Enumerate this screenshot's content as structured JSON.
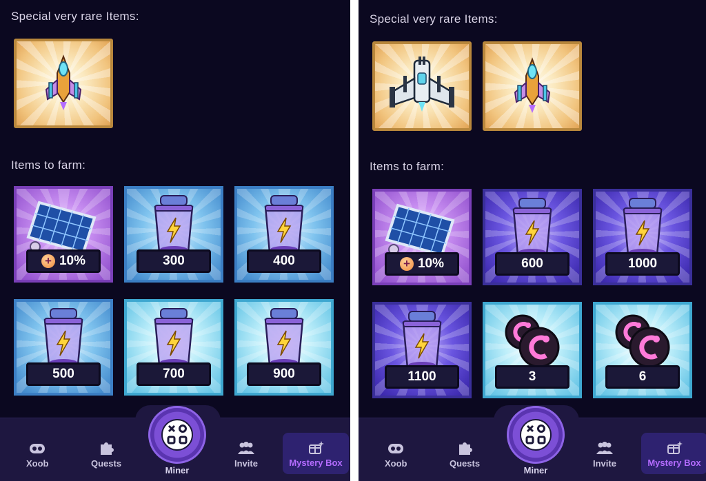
{
  "screens": [
    {
      "rare_heading": "Special very rare Items:",
      "rare_items": [
        {
          "icon": "golden-spaceship-icon"
        }
      ],
      "farm_heading": "Items to farm:",
      "farm_items": [
        {
          "icon": "solar-panel-icon",
          "value": "10%",
          "tone": "purple",
          "badge": "+"
        },
        {
          "icon": "energy-battery-icon",
          "value": "300",
          "tone": "blue"
        },
        {
          "icon": "energy-battery-icon",
          "value": "400",
          "tone": "blue"
        },
        {
          "icon": "energy-battery-icon",
          "value": "500",
          "tone": "blue"
        },
        {
          "icon": "energy-battery-icon",
          "value": "700",
          "tone": "cyan"
        },
        {
          "icon": "energy-battery-icon",
          "value": "900",
          "tone": "cyan"
        }
      ]
    },
    {
      "rare_heading": "Special very rare Items:",
      "rare_items": [
        {
          "icon": "silver-spaceship-icon"
        },
        {
          "icon": "golden-spaceship-icon"
        }
      ],
      "farm_heading": "Items to farm:",
      "farm_items": [
        {
          "icon": "solar-panel-icon",
          "value": "10%",
          "tone": "purple",
          "badge": "+"
        },
        {
          "icon": "energy-battery-icon",
          "value": "600",
          "tone": "indigo"
        },
        {
          "icon": "energy-battery-icon",
          "value": "1000",
          "tone": "indigo"
        },
        {
          "icon": "energy-battery-icon",
          "value": "1100",
          "tone": "indigo"
        },
        {
          "icon": "coin-icon",
          "value": "3",
          "tone": "cyan"
        },
        {
          "icon": "coin-icon",
          "value": "6",
          "tone": "cyan"
        }
      ]
    }
  ],
  "nav": {
    "xoob": "Xoob",
    "quests": "Quests",
    "miner": "Miner",
    "invite": "Invite",
    "mystery_box": "Mystery Box"
  },
  "colors": {
    "background": "#0b0820",
    "nav_bg": "#1e1740",
    "mystery_accent": "#b46cff",
    "rare_border": "#b8873c"
  }
}
